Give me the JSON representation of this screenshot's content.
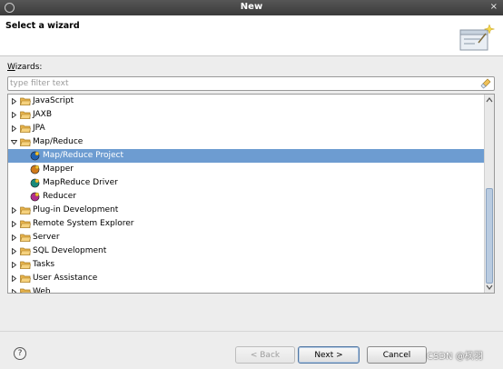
{
  "window": {
    "title": "New",
    "close_glyph": "×",
    "app_icon": "eclipse-icon"
  },
  "header": {
    "title": "Select a wizard",
    "banner_icon": "wizard-banner-icon"
  },
  "wizards": {
    "label_mnemonic": "W",
    "label_rest": "izards:"
  },
  "filter": {
    "placeholder": "type filter text",
    "value": "",
    "clear_icon": "clear-filter-icon"
  },
  "tree": {
    "items": [
      {
        "label": "JavaScript",
        "expanded": false,
        "icon": "folder-icon"
      },
      {
        "label": "JAXB",
        "expanded": false,
        "icon": "folder-icon"
      },
      {
        "label": "JPA",
        "expanded": false,
        "icon": "folder-icon"
      },
      {
        "label": "Map/Reduce",
        "expanded": true,
        "icon": "folder-icon"
      },
      {
        "label": "Map/Reduce Project",
        "child": true,
        "selected": true,
        "icon": "mapreduce-project-icon"
      },
      {
        "label": "Mapper",
        "child": true,
        "icon": "mapper-icon"
      },
      {
        "label": "MapReduce Driver",
        "child": true,
        "icon": "driver-icon"
      },
      {
        "label": "Reducer",
        "child": true,
        "icon": "reducer-icon"
      },
      {
        "label": "Plug-in Development",
        "expanded": false,
        "icon": "folder-icon"
      },
      {
        "label": "Remote System Explorer",
        "expanded": false,
        "icon": "folder-icon"
      },
      {
        "label": "Server",
        "expanded": false,
        "icon": "folder-icon"
      },
      {
        "label": "SQL Development",
        "expanded": false,
        "icon": "folder-icon"
      },
      {
        "label": "Tasks",
        "expanded": false,
        "icon": "folder-icon"
      },
      {
        "label": "User Assistance",
        "expanded": false,
        "icon": "folder-icon"
      },
      {
        "label": "Web",
        "expanded": false,
        "icon": "folder-icon"
      }
    ],
    "scroll_position": 0.6
  },
  "footer": {
    "help_label": "?",
    "back_label": "< Back",
    "next_label": "Next >",
    "cancel_label": "Cancel",
    "watermark": "CSDN @枫羽"
  },
  "colors": {
    "selection": "#6d9cd1",
    "folder": "#e9b44c"
  }
}
